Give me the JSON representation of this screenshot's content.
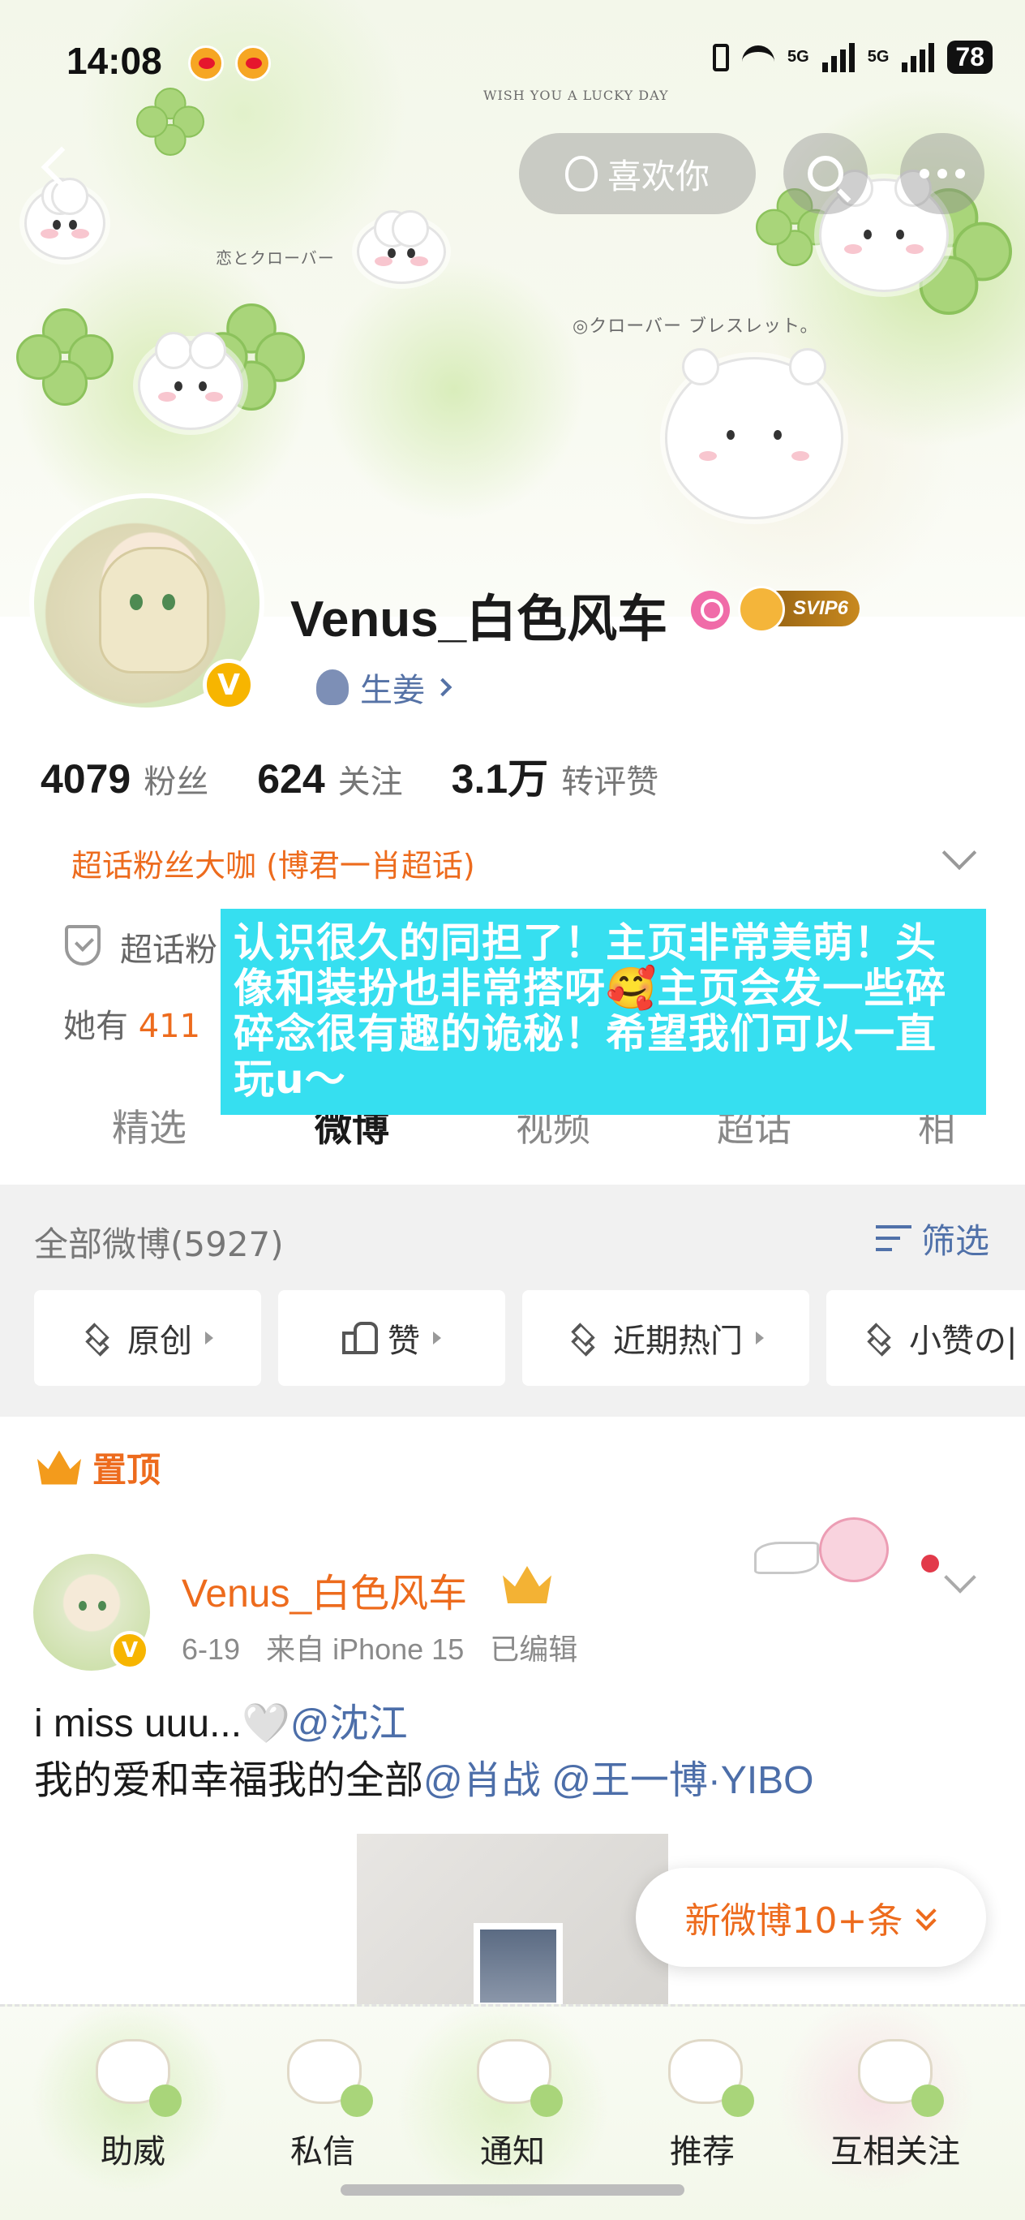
{
  "status_bar": {
    "time": "14:08",
    "network_a": "5G",
    "network_b": "5G",
    "battery": "78"
  },
  "nav": {
    "like_label": "喜欢你"
  },
  "banner_deco": {
    "lucky": "WISH YOU A LUCKY DAY",
    "clover_jp": "恋とクローバー",
    "bracelet_jp": "◎クローバー ブレスレット。"
  },
  "profile": {
    "name": "Venus_白色风车",
    "vip": "SVIP6",
    "verified_mark": "V",
    "tag": "生姜",
    "stats": [
      {
        "num": "4079",
        "label": "粉丝"
      },
      {
        "num": "624",
        "label": "关注"
      },
      {
        "num": "3.1万",
        "label": "转评赞"
      }
    ],
    "superfan": "超话粉丝大咖 (博君一肖超话)",
    "cert_prefix": "超话粉",
    "she_has_prefix": "她有",
    "she_has_num": "411"
  },
  "overlay_note": "认识很久的同担了！主页非常美萌！头像和装扮也非常搭呀🥰主页会发一些碎碎念很有趣的诡秘！希望我们可以一直玩u～",
  "tabs": [
    {
      "label": "精选"
    },
    {
      "label": "微博"
    },
    {
      "label": "视频"
    },
    {
      "label": "超话"
    },
    {
      "label": "相"
    }
  ],
  "filter": {
    "all_weibo": "全部微博(5927)",
    "filter_label": "筛选",
    "chips": [
      {
        "label": "原创"
      },
      {
        "label": "赞"
      },
      {
        "label": "近期热门"
      },
      {
        "label": "小赞の|"
      }
    ]
  },
  "post": {
    "pinned_label": "置顶",
    "author": "Venus_白色风车",
    "date": "6-19",
    "source": "来自 iPhone 15",
    "edited": "已编辑",
    "line1_text": "i miss uuu...🤍",
    "line1_mention": "@沈江",
    "line2_text": "我的爱和幸福我的全部",
    "line2_mention_a": "@肖战",
    "line2_mention_b": "@王一博·YIBO"
  },
  "new_posts": "新微博10+条",
  "bottom_nav": [
    {
      "label": "助威"
    },
    {
      "label": "私信"
    },
    {
      "label": "通知"
    },
    {
      "label": "推荐"
    },
    {
      "label": "互相关注"
    }
  ],
  "colors": {
    "accent_orange": "#ed6b1d",
    "link_blue": "#4c6ea9",
    "overlay_cyan": "#36dff0"
  }
}
